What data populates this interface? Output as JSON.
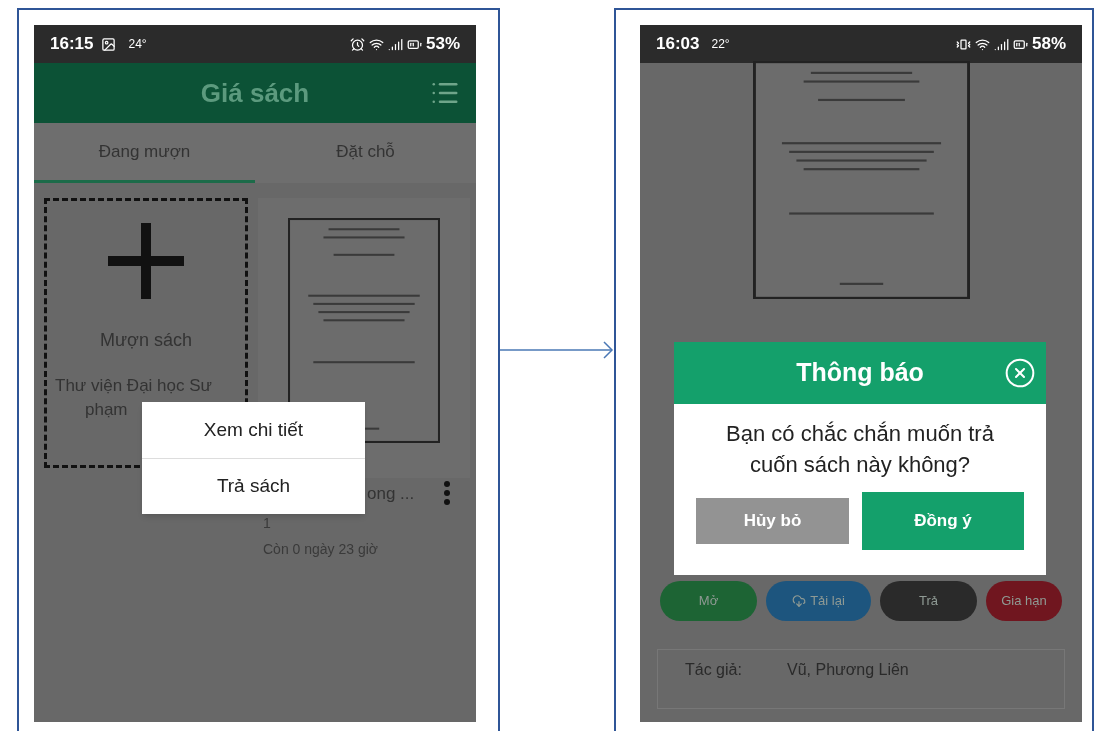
{
  "left_screen": {
    "status_bar": {
      "time": "16:15",
      "temperature": "24°",
      "battery": "53%"
    },
    "header": {
      "title": "Giá sách"
    },
    "tabs": [
      {
        "label": "Đang mượn",
        "selected": true
      },
      {
        "label": "Đặt chỗ",
        "selected": false
      }
    ],
    "add_card": {
      "label": "Mượn sách",
      "library": "Thư viện Đại học Sư phạm"
    },
    "book": {
      "title": "ong ...",
      "count": "1",
      "remaining": "Còn 0 ngày 23 giờ"
    },
    "context_menu": [
      "Xem chi tiết",
      "Trả sách"
    ]
  },
  "right_screen": {
    "status_bar": {
      "time": "16:03",
      "temperature": "22°",
      "battery": "58%"
    },
    "dialog": {
      "title": "Thông báo",
      "message": "Bạn có chắc chắn muốn trả cuốn sách này không?",
      "buttons": [
        {
          "label": "Hủy bỏ",
          "kind": "cancel"
        },
        {
          "label": "Đồng ý",
          "kind": "confirm"
        }
      ]
    },
    "actions": [
      {
        "label": "Mở",
        "color": "#1d6434",
        "kind": "plain"
      },
      {
        "label": "Tải lại",
        "color": "#1d557e",
        "kind": "cloud"
      },
      {
        "label": "Trả",
        "color": "#2a2a2a",
        "kind": "plain"
      },
      {
        "label": "Gia hạn",
        "color": "#70161f",
        "kind": "plain"
      }
    ],
    "details": [
      {
        "label": "Tác giả:",
        "value": "Vũ, Phương Liên"
      }
    ]
  }
}
